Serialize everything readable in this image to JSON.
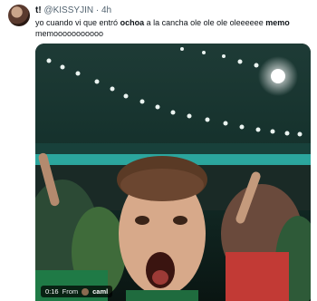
{
  "tweet": {
    "display_name": "t!",
    "handle": "@KISSYJIN",
    "separator": "·",
    "time": "4h",
    "text_parts": [
      "yo cuando vi que entró ",
      "ochoa",
      " a la cancha ole ole ole oleeeeee ",
      "memo",
      " memooooooooooo"
    ]
  },
  "video": {
    "duration": "0:16",
    "from_label": "From",
    "source_user": "caml"
  },
  "colors": {
    "text": "#0f1419",
    "secondary": "#536471",
    "badge_bg": "#000000"
  },
  "icons": [
    "avatar",
    "play-video"
  ]
}
